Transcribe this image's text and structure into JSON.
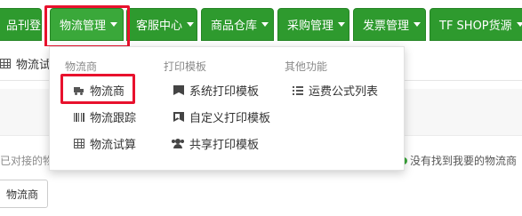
{
  "nav": {
    "tabs": [
      {
        "label": "品刊登",
        "caret": true
      },
      {
        "label": "物流管理",
        "caret": true
      },
      {
        "label": "客服中心",
        "caret": true
      },
      {
        "label": "商品仓库",
        "caret": true
      },
      {
        "label": "采购管理",
        "caret": true
      },
      {
        "label": "发票管理",
        "caret": true
      },
      {
        "label": "TF SHOP货源",
        "caret": true
      }
    ],
    "active_tab": "物流管理"
  },
  "subbar": {
    "item_label": "物流试"
  },
  "page": {
    "left_hint": "已对接的物",
    "right_hint": "没有找到我要的物流商",
    "bottom_button": "物流商"
  },
  "dropdown": {
    "columns": [
      {
        "header": "物流商",
        "items": [
          {
            "label": "物流商",
            "icon": "truck-icon"
          },
          {
            "label": "物流跟踪",
            "icon": "barcode-icon"
          },
          {
            "label": "物流试算",
            "icon": "table-icon"
          }
        ]
      },
      {
        "header": "打印模板",
        "items": [
          {
            "label": "系统打印模板",
            "icon": "bookmark-icon"
          },
          {
            "label": "自定义打印模板",
            "icon": "bookmark-outline-icon"
          },
          {
            "label": "共享打印模板",
            "icon": "users-icon"
          }
        ]
      },
      {
        "header": "其他功能",
        "items": [
          {
            "label": "运费公式列表",
            "icon": "list-icon"
          }
        ]
      }
    ]
  },
  "colors": {
    "nav_green": "#2e9a2e",
    "highlight_red": "#e8112d",
    "ok_green": "#3aa83a"
  }
}
